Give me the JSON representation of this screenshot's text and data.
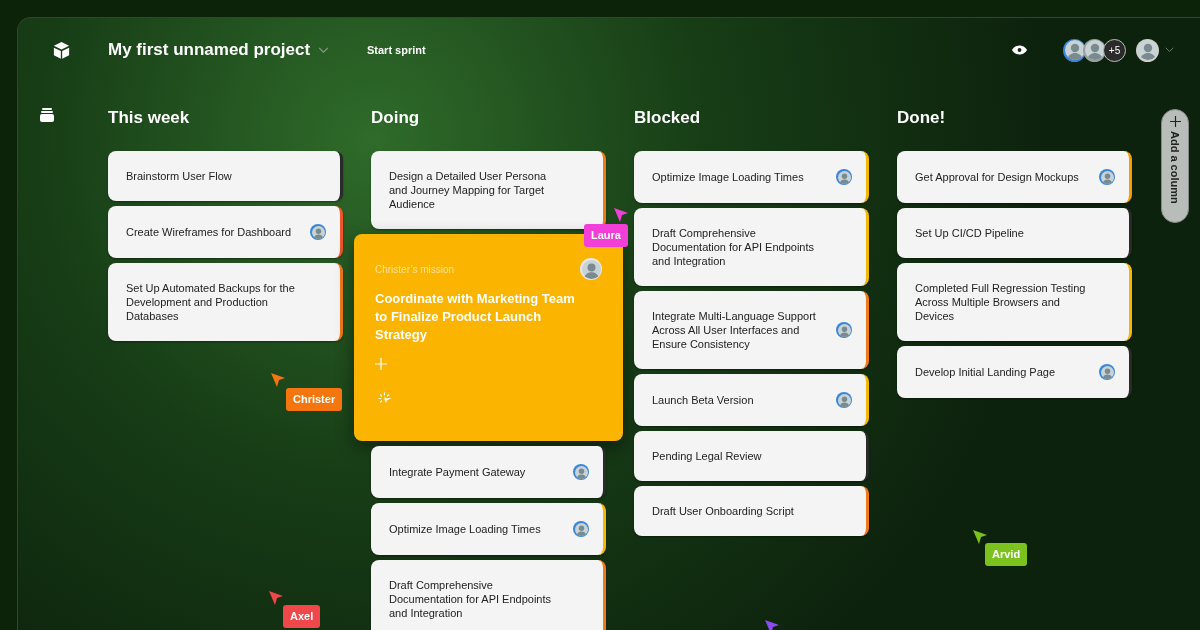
{
  "project": {
    "title": "My first unnamed project",
    "action": "Start sprint"
  },
  "team": {
    "more": "+5"
  },
  "columns": [
    {
      "title": "This week",
      "cards": [
        {
          "kind": "task",
          "title": "Brainstorm User Flow",
          "color": "#2a2a2a",
          "assigned": false
        },
        {
          "kind": "task",
          "title": "Create Wireframes for Dashboard",
          "color": "#f0562a",
          "assigned": true
        },
        {
          "kind": "task",
          "title": "Set Up Automated Backups for the Development and Production Databases",
          "color": "#f07a1a",
          "assigned": false
        }
      ]
    },
    {
      "title": "Doing",
      "cards": [
        {
          "kind": "task",
          "title": "Design a Detailed User Persona and Journey Mapping for Target Audience",
          "color": "#f07a1a",
          "assigned": false
        },
        {
          "kind": "mission",
          "label": "Christer’s mission",
          "title": "Coordinate with Marketing Team to Finalize Product Launch Strategy",
          "color": "#fbb400",
          "assigned": true
        },
        {
          "kind": "task",
          "title": "Integrate Payment Gateway",
          "color": "#2a2a2a",
          "assigned": true
        },
        {
          "kind": "task",
          "title": "Optimize Image Loading Times",
          "color": "#f5b800",
          "assigned": true
        },
        {
          "kind": "task",
          "title": "Draft Comprehensive Documentation for API Endpoints and Integration",
          "color": "#f07a1a",
          "assigned": false
        }
      ]
    },
    {
      "title": "Blocked",
      "cards": [
        {
          "kind": "task",
          "title": "Optimize Image Loading Times",
          "color": "#f5b800",
          "assigned": true
        },
        {
          "kind": "task",
          "title": "Draft Comprehensive Documentation for API Endpoints and Integration",
          "color": "#f5b800",
          "assigned": false
        },
        {
          "kind": "task",
          "title": "Integrate Multi-Language Support Across All User Interfaces and Ensure Consistency",
          "color": "#f07a1a",
          "assigned": true
        },
        {
          "kind": "task",
          "title": "Launch Beta Version",
          "color": "#f5b800",
          "assigned": true
        },
        {
          "kind": "task",
          "title": "Pending Legal Review",
          "color": "#2a2a2a",
          "assigned": false
        },
        {
          "kind": "task",
          "title": "Draft User Onboarding Script",
          "color": "#f07a1a",
          "assigned": false
        }
      ]
    },
    {
      "title": "Done!",
      "cards": [
        {
          "kind": "task",
          "title": "Get Approval for Design Mockups",
          "color": "#f5a000",
          "assigned": true
        },
        {
          "kind": "task",
          "title": "Set Up CI/CD Pipeline",
          "color": "#2a2a2a",
          "assigned": false
        },
        {
          "kind": "task",
          "title": "Completed Full Regression Testing Across Multiple Browsers and Devices",
          "color": "#f5b800",
          "assigned": false
        },
        {
          "kind": "task",
          "title": "Develop Initial Landing Page",
          "color": "#2a2a2a",
          "assigned": true
        }
      ]
    }
  ],
  "add_column": "Add a column",
  "cursors": [
    {
      "name": "Laura",
      "color": "#f23fd8"
    },
    {
      "name": "Christer",
      "color": "#f5760f"
    },
    {
      "name": "Axel",
      "color": "#f0474a"
    },
    {
      "name": "Arvid",
      "color": "#7cc21e"
    },
    {
      "color": "#8b4cf0"
    }
  ]
}
